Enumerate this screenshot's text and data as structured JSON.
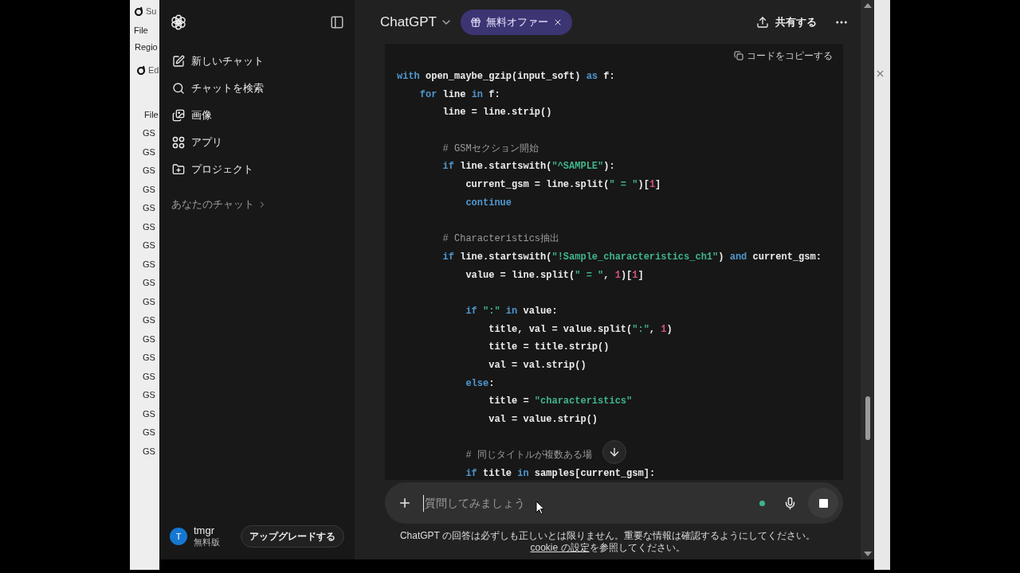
{
  "background_window": {
    "title": "Su",
    "menu": "File",
    "region": "Regio",
    "child_title": "Ed",
    "column_1": "File",
    "rows": [
      "GS",
      "GS",
      "GS",
      "GS",
      "GS",
      "GS",
      "GS",
      "GS",
      "GS",
      "GS",
      "GS",
      "GS",
      "GS",
      "GS",
      "GS",
      "GS",
      "GS",
      "GS"
    ]
  },
  "sidebar": {
    "items": [
      {
        "label": "新しいチャット"
      },
      {
        "label": "チャットを検索"
      },
      {
        "label": "画像"
      },
      {
        "label": "アプリ"
      },
      {
        "label": "プロジェクト"
      }
    ],
    "section": "あなたのチャット",
    "user": {
      "initial": "T",
      "name": "tmgr",
      "plan": "無料版"
    },
    "upgrade_button": "アップグレードする"
  },
  "header": {
    "model": "ChatGPT",
    "offer": "無料オファー",
    "share": "共有する"
  },
  "code_block": {
    "copy_label": "コードをコピーする",
    "lines": [
      {
        "kind": "code",
        "tokens": [
          {
            "kind": "kw",
            "t": "with"
          },
          {
            "kind": "txt",
            "t": " open_maybe_gzip(input_soft) "
          },
          {
            "kind": "kw",
            "t": "as"
          },
          {
            "kind": "txt",
            "t": " f:"
          }
        ]
      },
      {
        "kind": "code",
        "tokens": [
          {
            "kind": "kw",
            "t": "    for"
          },
          {
            "kind": "txt",
            "t": " line "
          },
          {
            "kind": "kw",
            "t": "in"
          },
          {
            "kind": "txt",
            "t": " f:"
          }
        ]
      },
      {
        "kind": "code",
        "tokens": [
          {
            "kind": "txt",
            "t": "        line = line.strip()"
          }
        ]
      },
      {
        "kind": "blank"
      },
      {
        "kind": "code",
        "tokens": [
          {
            "kind": "com",
            "t": "        # GSMセクション開始"
          }
        ]
      },
      {
        "kind": "code",
        "tokens": [
          {
            "kind": "kw",
            "t": "        if"
          },
          {
            "kind": "txt",
            "t": " line.startswith("
          },
          {
            "kind": "str",
            "t": "\"^SAMPLE\""
          },
          {
            "kind": "txt",
            "t": "):"
          }
        ]
      },
      {
        "kind": "code",
        "tokens": [
          {
            "kind": "txt",
            "t": "            current_gsm = line.split("
          },
          {
            "kind": "str",
            "t": "\" = \""
          },
          {
            "kind": "txt",
            "t": ")["
          },
          {
            "kind": "num",
            "t": "1"
          },
          {
            "kind": "txt",
            "t": "]"
          }
        ]
      },
      {
        "kind": "code",
        "tokens": [
          {
            "kind": "kw",
            "t": "            continue"
          }
        ]
      },
      {
        "kind": "blank"
      },
      {
        "kind": "code",
        "tokens": [
          {
            "kind": "com",
            "t": "        # Characteristics抽出"
          }
        ]
      },
      {
        "kind": "code",
        "tokens": [
          {
            "kind": "kw",
            "t": "        if"
          },
          {
            "kind": "txt",
            "t": " line.startswith("
          },
          {
            "kind": "str",
            "t": "\"!Sample_characteristics_ch1\""
          },
          {
            "kind": "txt",
            "t": ") "
          },
          {
            "kind": "kw",
            "t": "and"
          },
          {
            "kind": "txt",
            "t": " current_gsm:"
          }
        ]
      },
      {
        "kind": "code",
        "tokens": [
          {
            "kind": "txt",
            "t": "            value = line.split("
          },
          {
            "kind": "str",
            "t": "\" = \""
          },
          {
            "kind": "txt",
            "t": ", "
          },
          {
            "kind": "num",
            "t": "1"
          },
          {
            "kind": "txt",
            "t": ")["
          },
          {
            "kind": "num",
            "t": "1"
          },
          {
            "kind": "txt",
            "t": "]"
          }
        ]
      },
      {
        "kind": "blank"
      },
      {
        "kind": "code",
        "tokens": [
          {
            "kind": "kw",
            "t": "            if"
          },
          {
            "kind": "str",
            "t": " \":\""
          },
          {
            "kind": "kw",
            "t": " in"
          },
          {
            "kind": "txt",
            "t": " value:"
          }
        ]
      },
      {
        "kind": "code",
        "tokens": [
          {
            "kind": "txt",
            "t": "                title, val = value.split("
          },
          {
            "kind": "str",
            "t": "\":\""
          },
          {
            "kind": "txt",
            "t": ", "
          },
          {
            "kind": "num",
            "t": "1"
          },
          {
            "kind": "txt",
            "t": ")"
          }
        ]
      },
      {
        "kind": "code",
        "tokens": [
          {
            "kind": "txt",
            "t": "                title = title.strip()"
          }
        ]
      },
      {
        "kind": "code",
        "tokens": [
          {
            "kind": "txt",
            "t": "                val = val.strip()"
          }
        ]
      },
      {
        "kind": "code",
        "tokens": [
          {
            "kind": "kw",
            "t": "            else"
          },
          {
            "kind": "txt",
            "t": ":"
          }
        ]
      },
      {
        "kind": "code",
        "tokens": [
          {
            "kind": "txt",
            "t": "                title = "
          },
          {
            "kind": "str",
            "t": "\"characteristics\""
          }
        ]
      },
      {
        "kind": "code",
        "tokens": [
          {
            "kind": "txt",
            "t": "                val = value.strip()"
          }
        ]
      },
      {
        "kind": "blank"
      },
      {
        "kind": "code",
        "tokens": [
          {
            "kind": "com",
            "t": "            # 同じタイトルが複数ある場"
          }
        ]
      },
      {
        "kind": "code",
        "tokens": [
          {
            "kind": "kw",
            "t": "            if"
          },
          {
            "kind": "txt",
            "t": " title "
          },
          {
            "kind": "kw",
            "t": "in"
          },
          {
            "kind": "txt",
            "t": " samples[current_gsm]:"
          }
        ]
      }
    ]
  },
  "composer": {
    "placeholder": "質問してみましょう"
  },
  "disclaimer": {
    "text": "ChatGPT の回答は必ずしも正しいとは限りません。重要な情報は確認するようにしてください。",
    "link": "cookie の設定",
    "after": "を参照してください。"
  }
}
